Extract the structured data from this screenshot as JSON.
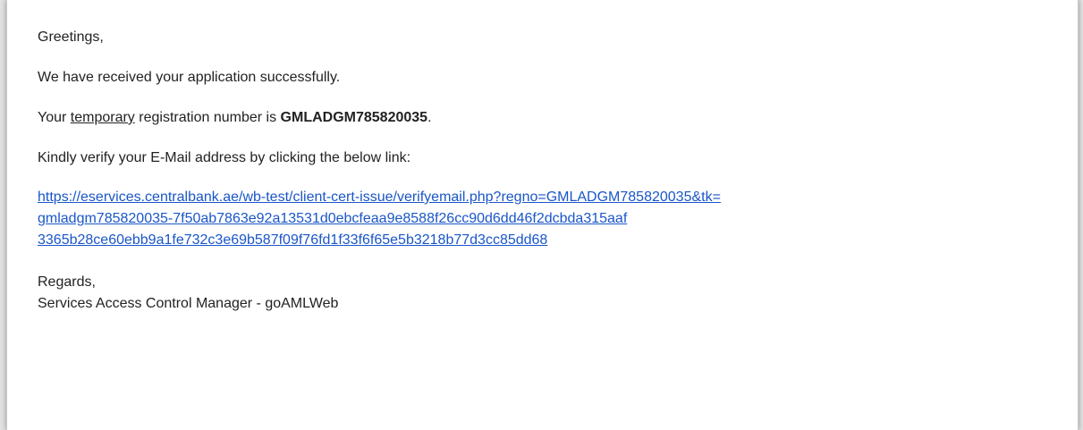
{
  "email": {
    "greeting": "Greetings,",
    "received_line": "We have received your application successfully.",
    "registration": {
      "prefix": "Your ",
      "temporary_word": "temporary",
      "middle": " registration number is ",
      "number": "GMLADGM785820035",
      "suffix": "."
    },
    "verify_instruction": "Kindly verify your E-Mail address by clicking the below link:",
    "verify_link": {
      "line1": "https://eservices.centralbank.ae/wb-test/client-cert-issue/verifyemail.php?regno=GMLADGM785820035&tk=",
      "line2": "gmladgm785820035-7f50ab7863e92a13531d0ebcfeaa9e8588f26cc90d6dd46f2dcbda315aaf",
      "line3": "3365b28ce60ebb9a1fe732c3e69b587f09f76fd1f33f6f65e5b3218b77d3cc85dd68"
    },
    "signoff": "Regards,",
    "signature": "Services Access Control Manager - goAMLWeb"
  },
  "colors": {
    "text": "#222222",
    "link": "#1a56c8",
    "background": "#ffffff"
  }
}
